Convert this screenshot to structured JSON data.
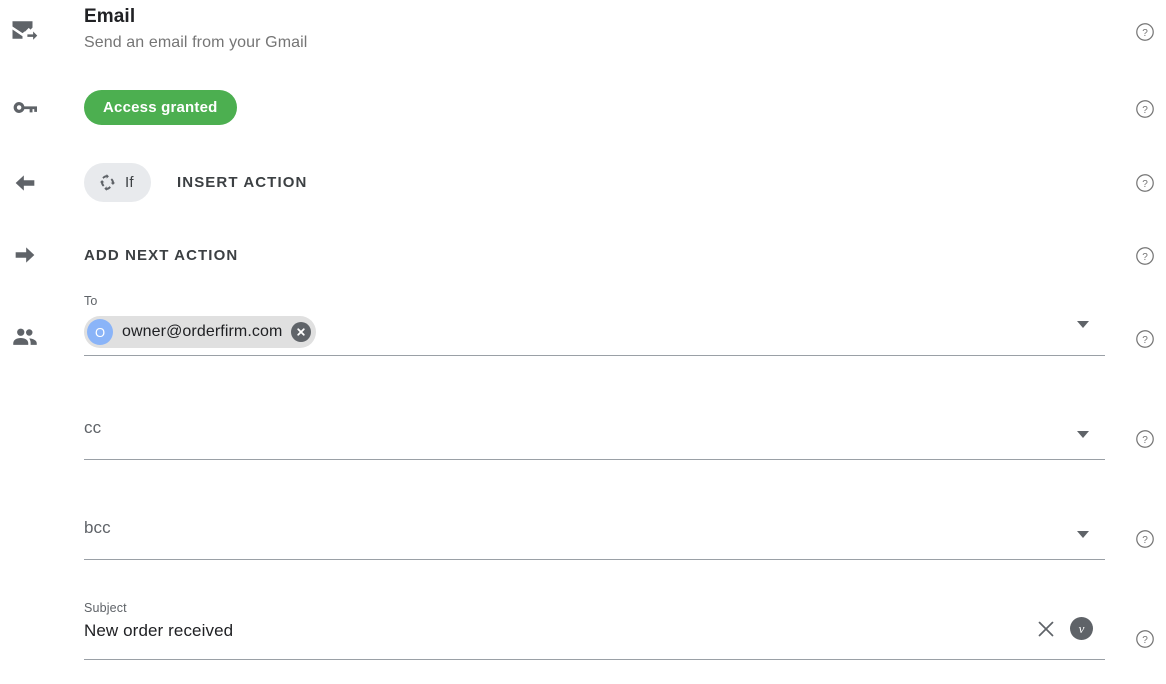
{
  "header": {
    "title": "Email",
    "subtitle": "Send an email from your Gmail"
  },
  "status": {
    "access_label": "Access granted",
    "access_color": "#4caf50"
  },
  "actions": {
    "if_label": "If",
    "insert_action_label": "INSERT ACTION",
    "add_next_action_label": "ADD NEXT ACTION"
  },
  "rail": {
    "icons": [
      {
        "name": "send-email-icon"
      },
      {
        "name": "key-icon"
      },
      {
        "name": "arrow-left-icon"
      },
      {
        "name": "arrow-right-icon"
      },
      {
        "name": "people-icon"
      }
    ]
  },
  "form": {
    "to": {
      "label": "To",
      "chip": {
        "avatar_initial": "O",
        "avatar_color": "#8ab4f8",
        "text": "owner@orderfirm.com"
      }
    },
    "cc": {
      "placeholder": "cc"
    },
    "bcc": {
      "placeholder": "bcc"
    },
    "subject": {
      "label": "Subject",
      "value": "New order received",
      "variable_badge": "v"
    }
  },
  "help": {
    "icon_label": "?"
  }
}
